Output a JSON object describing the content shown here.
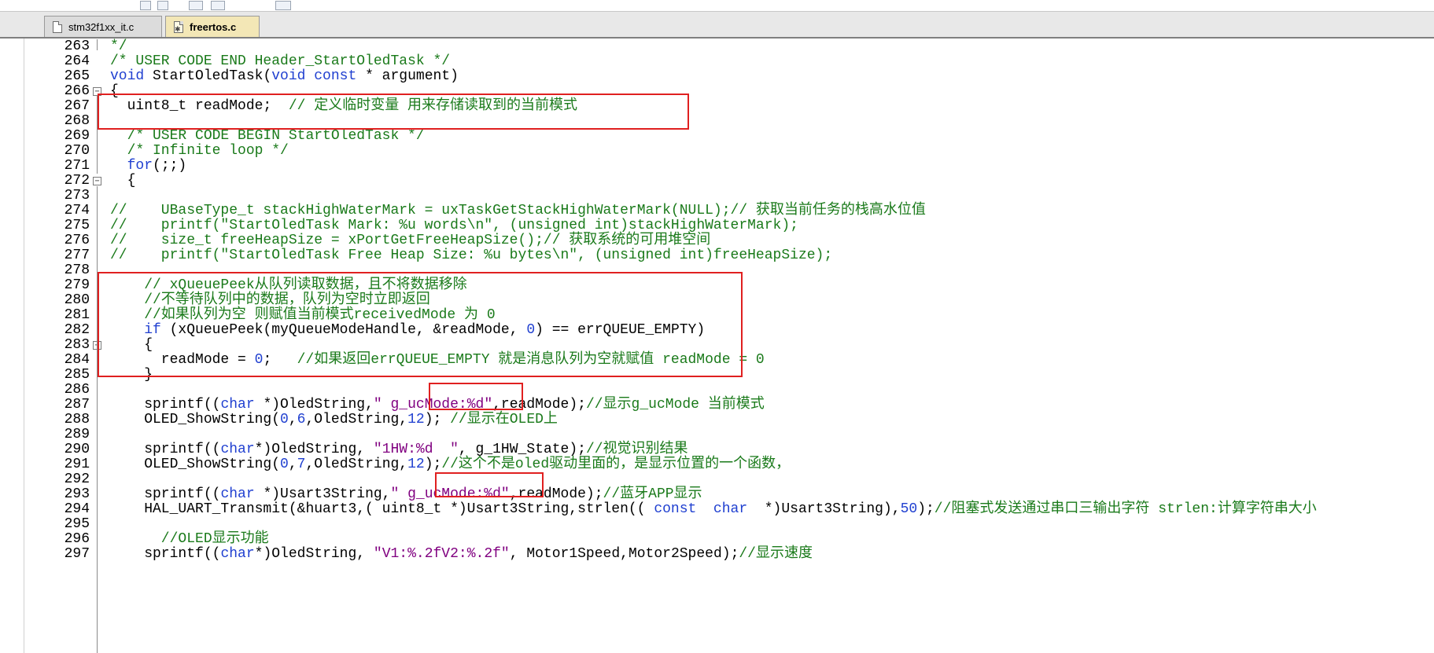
{
  "tabs": [
    {
      "label": "stm32f1xx_it.c",
      "active": false
    },
    {
      "label": "freertos.c",
      "active": true
    }
  ],
  "editor": {
    "lines": [
      {
        "n": "263",
        "segs": [
          {
            "t": "*/",
            "c": "cm"
          }
        ]
      },
      {
        "n": "264",
        "segs": [
          {
            "t": "/* USER CODE END Header_StartOledTask */",
            "c": "cm"
          }
        ]
      },
      {
        "n": "265",
        "segs": [
          {
            "t": "void",
            "c": "kw"
          },
          {
            "t": " StartOledTask(",
            "c": ""
          },
          {
            "t": "void const",
            "c": "kw"
          },
          {
            "t": " * argument)",
            "c": ""
          }
        ]
      },
      {
        "n": "266",
        "segs": [
          {
            "t": "{",
            "c": ""
          }
        ]
      },
      {
        "n": "267",
        "segs": [
          {
            "t": "  uint8_t readMode;  ",
            "c": ""
          },
          {
            "t": "// 定义临时变量 用来存储读取到的当前模式",
            "c": "cm"
          }
        ]
      },
      {
        "n": "268",
        "segs": []
      },
      {
        "n": "269",
        "segs": [
          {
            "t": "  /* USER CODE BEGIN StartOledTask */",
            "c": "cm"
          }
        ]
      },
      {
        "n": "270",
        "segs": [
          {
            "t": "  /* Infinite loop */",
            "c": "cm"
          }
        ]
      },
      {
        "n": "271",
        "segs": [
          {
            "t": "  ",
            "c": ""
          },
          {
            "t": "for",
            "c": "kw"
          },
          {
            "t": "(;;)",
            "c": ""
          }
        ]
      },
      {
        "n": "272",
        "segs": [
          {
            "t": "  {",
            "c": ""
          }
        ]
      },
      {
        "n": "273",
        "segs": []
      },
      {
        "n": "274",
        "segs": [
          {
            "t": "//    UBaseType_t stackHighWaterMark = uxTaskGetStackHighWaterMark(NULL);// 获取当前任务的栈高水位值",
            "c": "cm"
          }
        ]
      },
      {
        "n": "275",
        "segs": [
          {
            "t": "//    printf(\"StartOledTask Mark: %u words\\n\", (unsigned int)stackHighWaterMark);",
            "c": "cm"
          }
        ]
      },
      {
        "n": "276",
        "segs": [
          {
            "t": "//    size_t freeHeapSize = xPortGetFreeHeapSize();// 获取系统的可用堆空间",
            "c": "cm"
          }
        ]
      },
      {
        "n": "277",
        "segs": [
          {
            "t": "//    printf(\"StartOledTask Free Heap Size: %u bytes\\n\", (unsigned int)freeHeapSize);",
            "c": "cm"
          }
        ]
      },
      {
        "n": "278",
        "segs": []
      },
      {
        "n": "279",
        "segs": [
          {
            "t": "    // xQueuePeek从队列读取数据，且不将数据移除",
            "c": "cm"
          }
        ]
      },
      {
        "n": "280",
        "segs": [
          {
            "t": "    //不等待队列中的数据，队列为空时立即返回",
            "c": "cm"
          }
        ]
      },
      {
        "n": "281",
        "segs": [
          {
            "t": "    //如果队列为空 则赋值当前模式receivedMode 为 0",
            "c": "cm"
          }
        ]
      },
      {
        "n": "282",
        "segs": [
          {
            "t": "    ",
            "c": ""
          },
          {
            "t": "if",
            "c": "kw"
          },
          {
            "t": " (xQueuePeek(myQueueModeHandle, &readMode, ",
            "c": ""
          },
          {
            "t": "0",
            "c": "nm"
          },
          {
            "t": ") == errQUEUE_EMPTY)",
            "c": ""
          }
        ]
      },
      {
        "n": "283",
        "segs": [
          {
            "t": "    {",
            "c": ""
          }
        ]
      },
      {
        "n": "284",
        "segs": [
          {
            "t": "      readMode = ",
            "c": ""
          },
          {
            "t": "0",
            "c": "nm"
          },
          {
            "t": ";   ",
            "c": ""
          },
          {
            "t": "//如果返回errQUEUE_EMPTY 就是消息队列为空就赋值 readMode = 0",
            "c": "cm"
          }
        ]
      },
      {
        "n": "285",
        "segs": [
          {
            "t": "    }",
            "c": ""
          }
        ]
      },
      {
        "n": "286",
        "segs": []
      },
      {
        "n": "287",
        "segs": [
          {
            "t": "    sprintf((",
            "c": ""
          },
          {
            "t": "char",
            "c": "kw"
          },
          {
            "t": " *)OledString,",
            "c": ""
          },
          {
            "t": "\" g_ucMode:%d\"",
            "c": "st"
          },
          {
            "t": ",readMode);",
            "c": ""
          },
          {
            "t": "//显示g_ucMode 当前模式",
            "c": "cm"
          }
        ]
      },
      {
        "n": "288",
        "segs": [
          {
            "t": "    OLED_ShowString(",
            "c": ""
          },
          {
            "t": "0",
            "c": "nm"
          },
          {
            "t": ",",
            "c": ""
          },
          {
            "t": "6",
            "c": "nm"
          },
          {
            "t": ",OledString,",
            "c": ""
          },
          {
            "t": "12",
            "c": "nm"
          },
          {
            "t": "); ",
            "c": ""
          },
          {
            "t": "//显示在OLED上",
            "c": "cm"
          }
        ]
      },
      {
        "n": "289",
        "segs": []
      },
      {
        "n": "290",
        "segs": [
          {
            "t": "    sprintf((",
            "c": ""
          },
          {
            "t": "char",
            "c": "kw"
          },
          {
            "t": "*)OledString, ",
            "c": ""
          },
          {
            "t": "\"1HW:%d  \"",
            "c": "st"
          },
          {
            "t": ", g_1HW_State);",
            "c": ""
          },
          {
            "t": "//视觉识别结果",
            "c": "cm"
          }
        ]
      },
      {
        "n": "291",
        "segs": [
          {
            "t": "    OLED_ShowString(",
            "c": ""
          },
          {
            "t": "0",
            "c": "nm"
          },
          {
            "t": ",",
            "c": ""
          },
          {
            "t": "7",
            "c": "nm"
          },
          {
            "t": ",OledString,",
            "c": ""
          },
          {
            "t": "12",
            "c": "nm"
          },
          {
            "t": ");",
            "c": ""
          },
          {
            "t": "//这个不是oled驱动里面的，是显示位置的一个函数，",
            "c": "cm"
          }
        ]
      },
      {
        "n": "292",
        "segs": []
      },
      {
        "n": "293",
        "segs": [
          {
            "t": "    sprintf((",
            "c": ""
          },
          {
            "t": "char",
            "c": "kw"
          },
          {
            "t": " *)Usart3String,",
            "c": ""
          },
          {
            "t": "\" g_ucMode:%d\"",
            "c": "st"
          },
          {
            "t": ",readMode);",
            "c": ""
          },
          {
            "t": "//蓝牙APP显示",
            "c": "cm"
          }
        ]
      },
      {
        "n": "294",
        "segs": [
          {
            "t": "    HAL_UART_Transmit(&huart3,( uint8_t *)Usart3String,strlen(( ",
            "c": ""
          },
          {
            "t": "const  char",
            "c": "kw"
          },
          {
            "t": "  *)Usart3String),",
            "c": ""
          },
          {
            "t": "50",
            "c": "nm"
          },
          {
            "t": ");",
            "c": ""
          },
          {
            "t": "//阻塞式发送通过串口三输出字符 strlen:计算字符串大小",
            "c": "cm"
          }
        ]
      },
      {
        "n": "295",
        "segs": []
      },
      {
        "n": "296",
        "segs": [
          {
            "t": "      //OLED显示功能",
            "c": "cm"
          }
        ]
      },
      {
        "n": "297",
        "segs": [
          {
            "t": "    sprintf((",
            "c": ""
          },
          {
            "t": "char",
            "c": "kw"
          },
          {
            "t": "*)OledString, ",
            "c": ""
          },
          {
            "t": "\"V1:%.2fV2:%.2f\"",
            "c": "st"
          },
          {
            "t": ", Motor1Speed,Motor2Speed);",
            "c": ""
          },
          {
            "t": "//显示速度",
            "c": "cm"
          }
        ]
      }
    ]
  },
  "colors": {
    "keyword": "#1f3fd0",
    "comment": "#1a7a1a",
    "string": "#800080",
    "highlight_box": "#e02020",
    "active_tab": "#f3e7b6"
  }
}
